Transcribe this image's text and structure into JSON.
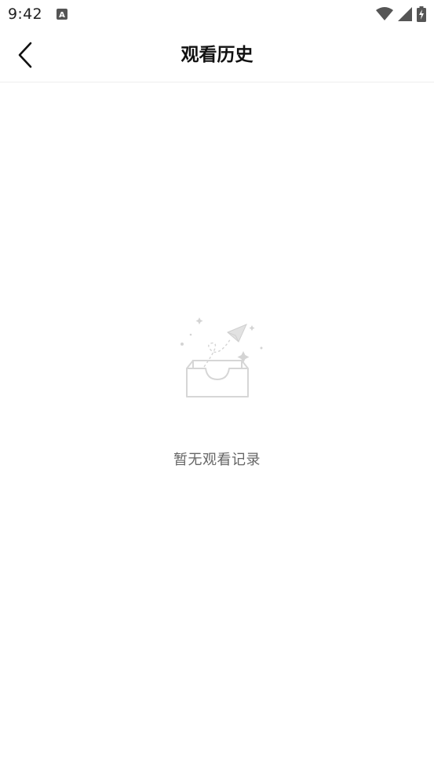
{
  "status_bar": {
    "time": "9:42",
    "app_icon_text": "A",
    "icons": [
      "wifi-icon",
      "signal-icon",
      "battery-charging-icon"
    ]
  },
  "header": {
    "title": "观看历史",
    "back_icon": "chevron-left-icon"
  },
  "empty_state": {
    "illustration": "empty-inbox-paper-plane-icon",
    "message": "暂无观看记录"
  },
  "colors": {
    "background": "#ffffff",
    "title": "#111111",
    "empty_text": "#666666",
    "illustration": "#dcdcdc",
    "divider": "#eeeeee"
  }
}
